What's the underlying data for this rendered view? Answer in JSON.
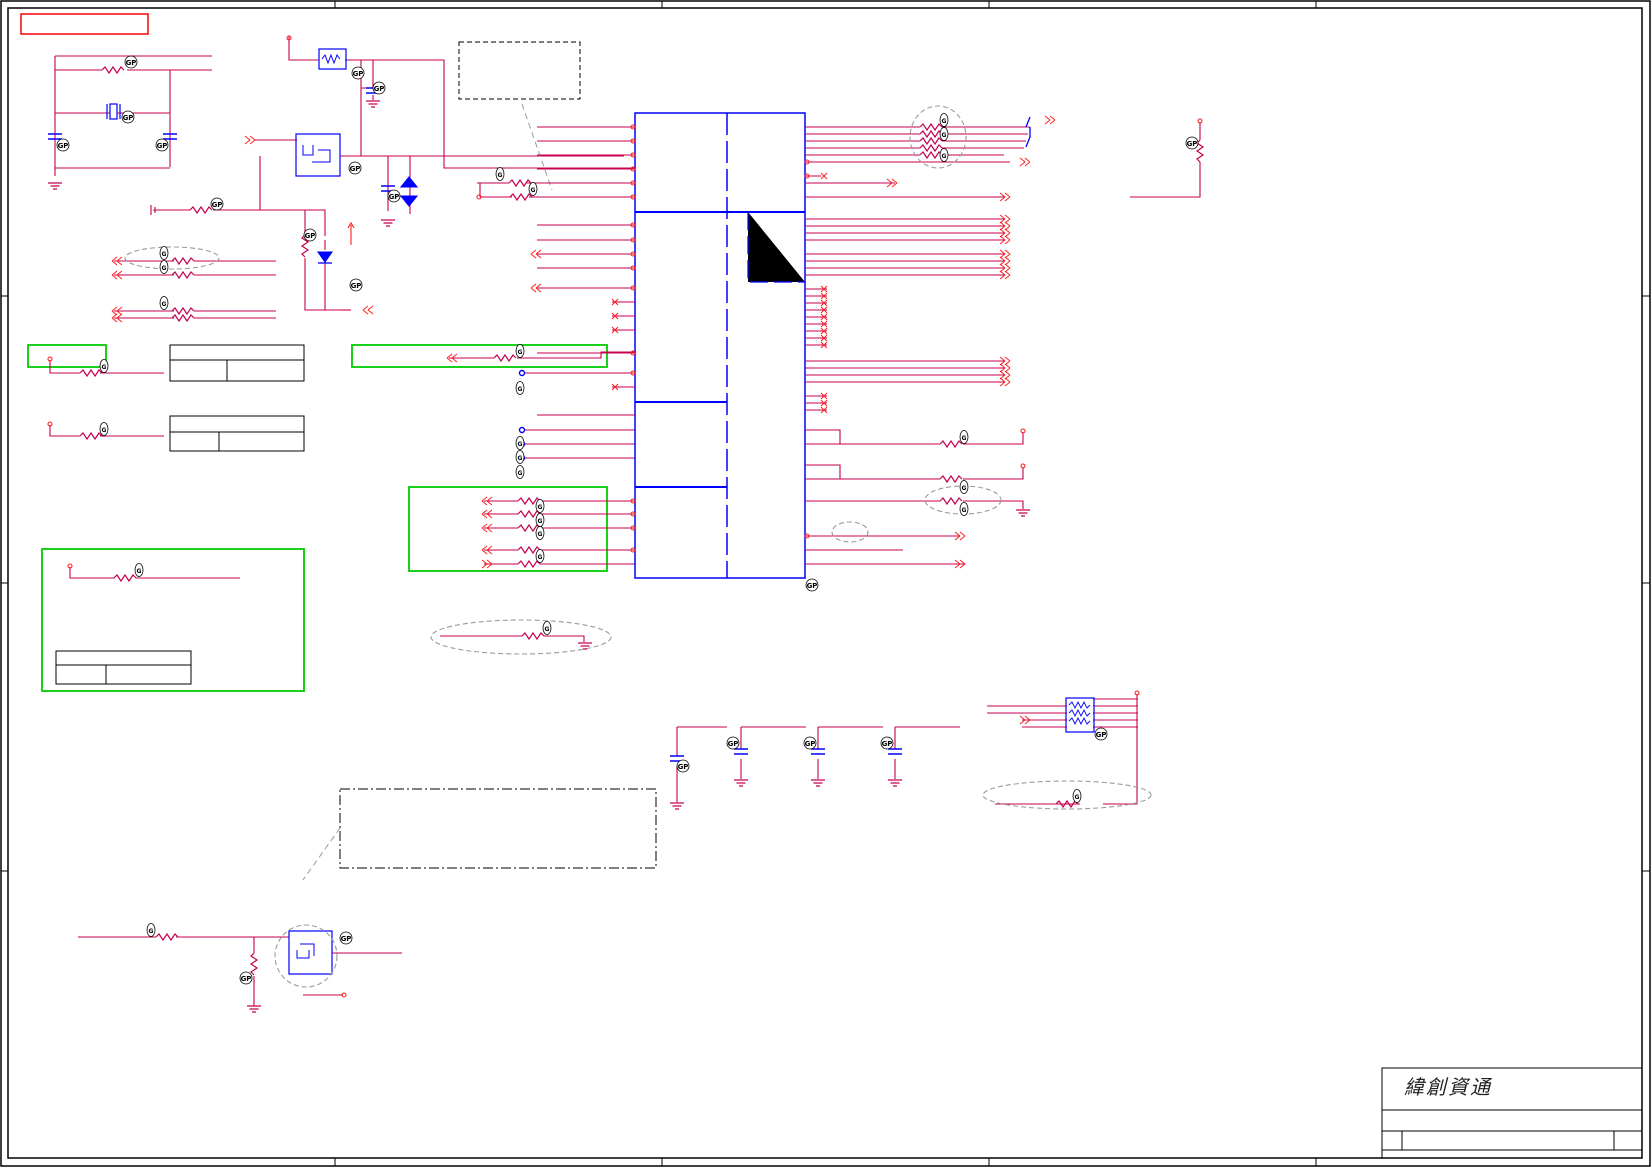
{
  "title_block": {
    "company_logo": "緯創資通"
  },
  "colors": {
    "wire": "#c8004f",
    "port": "#ff2020",
    "component": "#0000ff",
    "border": "#000000",
    "annotation_box": "#00cc00",
    "highlight_box": "#ff0000",
    "dashed_callout": "#9a9a9a"
  },
  "symbols": {
    "tag_icon": "gp-tag-icon",
    "resistor": "resistor-icon",
    "capacitor": "capacitor-icon",
    "ground": "ground-icon",
    "diode": "diode-icon",
    "crystal": "crystal-icon",
    "resistor_network": "resistor-network-icon",
    "bus_arrow": "double-chevron-icon"
  }
}
